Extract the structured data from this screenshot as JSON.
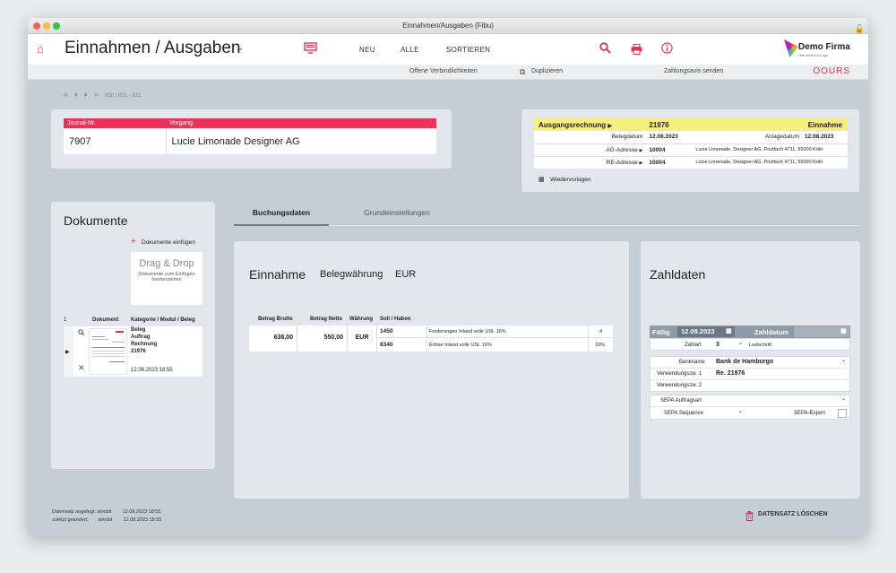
{
  "window": {
    "title": "Einnahmen/Ausgaben (Fibu)"
  },
  "toolbar": {
    "title": "Einnahmen / Ausgaben",
    "nav": [
      "NEU",
      "ALLE",
      "SORTIEREN"
    ],
    "logo_name": "Demo Firma",
    "logo_sub": "Hier steht Ihr Logo"
  },
  "subbar": {
    "items": [
      "Offene Verbindlichkeiten",
      "Duplizieren",
      "Zahlungsavis senden"
    ],
    "brand": "OOURS"
  },
  "pager": {
    "text": "830 / 831 - 831"
  },
  "journal": {
    "col1": "Jounal-Nr.",
    "col2": "Vorgang",
    "nr": "7907",
    "vorgang": "Lucie Limonade Designer AG"
  },
  "invoice": {
    "type": "Ausgangsrechnung",
    "number": "21976",
    "kind": "Einnahme",
    "belegdatum_label": "Belegdatum",
    "belegdatum": "12.08.2023",
    "anlagedatum_label": "Anlagedatum",
    "anlagedatum": "12.08.2023",
    "ag_label": "AG-Adresse",
    "ag_nr": "10004",
    "ag_address": "Lucie Limonade, Designer AG, Postfach 4711, 55000 Köln",
    "re_label": "RE-Adresse",
    "re_nr": "10004",
    "re_address": "Lucie Limonade, Designer AG, Postfach 4711, 55000 Köln",
    "wiedervorlagen": "Wiedervorlagen"
  },
  "documents": {
    "title": "Dokumente",
    "insert": "Dokumente einfügen",
    "drop_title": "Drag & Drop",
    "drop_sub": "Dokumente zum Einfügen hierherziehen",
    "count": "1",
    "col_doc": "Dokument",
    "col_cat": "Kategorie / Modul / Beleg",
    "cat1": "Beleg",
    "cat2": "Auftrag",
    "cat3": "Rechnung",
    "cat4": "21976",
    "date": "12.08.2023 18:55"
  },
  "tabs": [
    "Buchungsdaten",
    "Grundeinstellungen"
  ],
  "booking": {
    "title": "Einnahme",
    "currency_label": "Belegwährung",
    "currency": "EUR",
    "headers": [
      "Betrag Brutto",
      "Betrag Netto",
      "Währung",
      "Soll / Haben"
    ],
    "brutto": "638,00",
    "netto": "550,00",
    "waehrung": "EUR",
    "rows": [
      {
        "konto": "1450",
        "text": "Forderungen Inland volle USt. 16%",
        "val": "4"
      },
      {
        "konto": "8340",
        "text": "Erlöse Inland volle USt. 16%",
        "val": "16%"
      }
    ]
  },
  "payment": {
    "title": "Zahldaten",
    "faellig_label": "Fällig",
    "faellig": "12.08.2023",
    "zahldatum_label": "Zahldatum",
    "zahlart_label": "Zahlart",
    "zahlart": "3",
    "zahlart_text": "Lastschrift",
    "bankname_label": "Bankname",
    "bankname": "Bank de Hamburgo",
    "vz1_label": "Verwendungszw. 1",
    "vz1": "Re. 21976",
    "vz2_label": "Verwendungszw. 2",
    "sepa_auftrag_label": "SEPA Auftragsart",
    "sepa_seq_label": "SEPA Sequence",
    "sepa_export_label": "SEPA-Export"
  },
  "footer": {
    "created_label": "Datensatz angelegt:",
    "created_user": "sinobit",
    "created_date": "12.08.2023 18:55",
    "changed_label": "zuletzt geändert:",
    "changed_user": "sinobit",
    "changed_date": "12.08.2023 18:55",
    "delete": "DATENSATZ LÖSCHEN"
  }
}
